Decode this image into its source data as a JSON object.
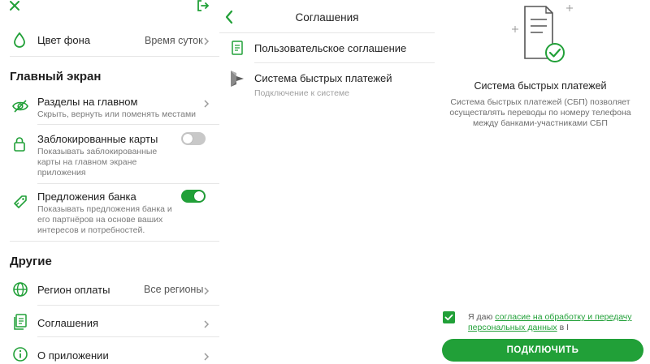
{
  "colors": {
    "accent": "#21a038",
    "toggle_off": "#c8c8c8",
    "text": "#1f1f1f",
    "muted": "#7a7a7a"
  },
  "settings": {
    "background_label": "Цвет фона",
    "background_value": "Время суток",
    "main_section": "Главный экран",
    "sections_title": "Разделы на главном",
    "sections_sub": "Скрыть, вернуть или поменять местами",
    "blocked_title": "Заблокированные карты",
    "blocked_sub_1": "Показывать заблокированные",
    "blocked_sub_2": "карты на главном экране",
    "blocked_sub_3": "приложения",
    "blocked_toggle": "off",
    "offers_title": "Предложения банка",
    "offers_sub_1": "Показывать предложения банка и",
    "offers_sub_2": "его партнёров на основе ваших",
    "offers_sub_3": "интересов и потребностей.",
    "offers_toggle": "on",
    "other_section": "Другие",
    "region_title": "Регион оплаты",
    "region_value": "Все регионы",
    "agreements_title": "Соглашения",
    "about_title": "О приложении"
  },
  "agreements": {
    "title": "Соглашения",
    "items": [
      {
        "title": "Пользовательское соглашение"
      },
      {
        "title": "Система быстрых платежей",
        "subtitle": "Подключение к системе"
      }
    ]
  },
  "sbp": {
    "title": "Система быстрых платежей",
    "desc_1": "Система быстрых платежей (СБП) позволяет",
    "desc_2": "осуществлять переводы по номеру телефона",
    "desc_3": "между банками-участниками СБП",
    "consent_prefix": "Я даю ",
    "consent_link_1": "согласие на обработку и передачу",
    "consent_link_2": "персональных данных",
    "consent_suffix": " в I",
    "connect_button": "ПОДКЛЮЧИТЬ"
  }
}
